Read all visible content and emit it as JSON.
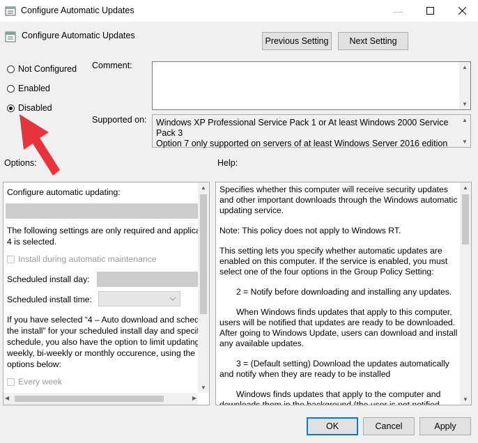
{
  "window": {
    "title": "Configure Automatic Updates"
  },
  "header": {
    "policy_name": "Configure Automatic Updates",
    "previous_button": "Previous Setting",
    "next_button": "Next Setting"
  },
  "state": {
    "not_configured": "Not Configured",
    "enabled": "Enabled",
    "disabled": "Disabled",
    "selected": "disabled"
  },
  "comment": {
    "label": "Comment:",
    "value": ""
  },
  "supported": {
    "label": "Supported on:",
    "line1": "Windows XP Professional Service Pack 1 or At least Windows 2000 Service Pack 3",
    "line2": "Option 7 only supported on servers of at least Windows Server 2016 edition"
  },
  "options": {
    "label": "Options:",
    "configure_label": "Configure automatic updating:",
    "note_line1": "The following settings are only required and applicab",
    "note_line2": "4 is selected.",
    "install_maintenance": "Install during automatic maintenance",
    "install_day_label": "Scheduled install day:",
    "install_time_label": "Scheduled install time:",
    "para_line1": "If you have selected “4 – Auto download and sched",
    "para_line2": "the install” for your scheduled install day and specifi",
    "para_line3": "schedule, you also have the option to limit updating",
    "para_line4": "weekly, bi-weekly or monthly occurence, using the",
    "para_line5": "options below:",
    "every_week": "Every week"
  },
  "help": {
    "label": "Help:",
    "p1": "Specifies whether this computer will receive security updates and other important downloads through the Windows automatic updating service.",
    "p2": "Note: This policy does not apply to Windows RT.",
    "p3": "This setting lets you specify whether automatic updates are enabled on this computer. If the service is enabled, you must select one of the four options in the Group Policy Setting:",
    "p4": "2 = Notify before downloading and installing any updates.",
    "p5": "When Windows finds updates that apply to this computer, users will be notified that updates are ready to be downloaded. After going to Windows Update, users can download and install any available updates.",
    "p6": "3 = (Default setting) Download the updates automatically and notify when they are ready to be installed",
    "p7": "Windows finds updates that apply to the computer and downloads them in the background (the user is not notified"
  },
  "footer": {
    "ok": "OK",
    "cancel": "Cancel",
    "apply": "Apply"
  },
  "colors": {
    "annotation_arrow": "#e8323c",
    "accent": "#0078d7"
  }
}
